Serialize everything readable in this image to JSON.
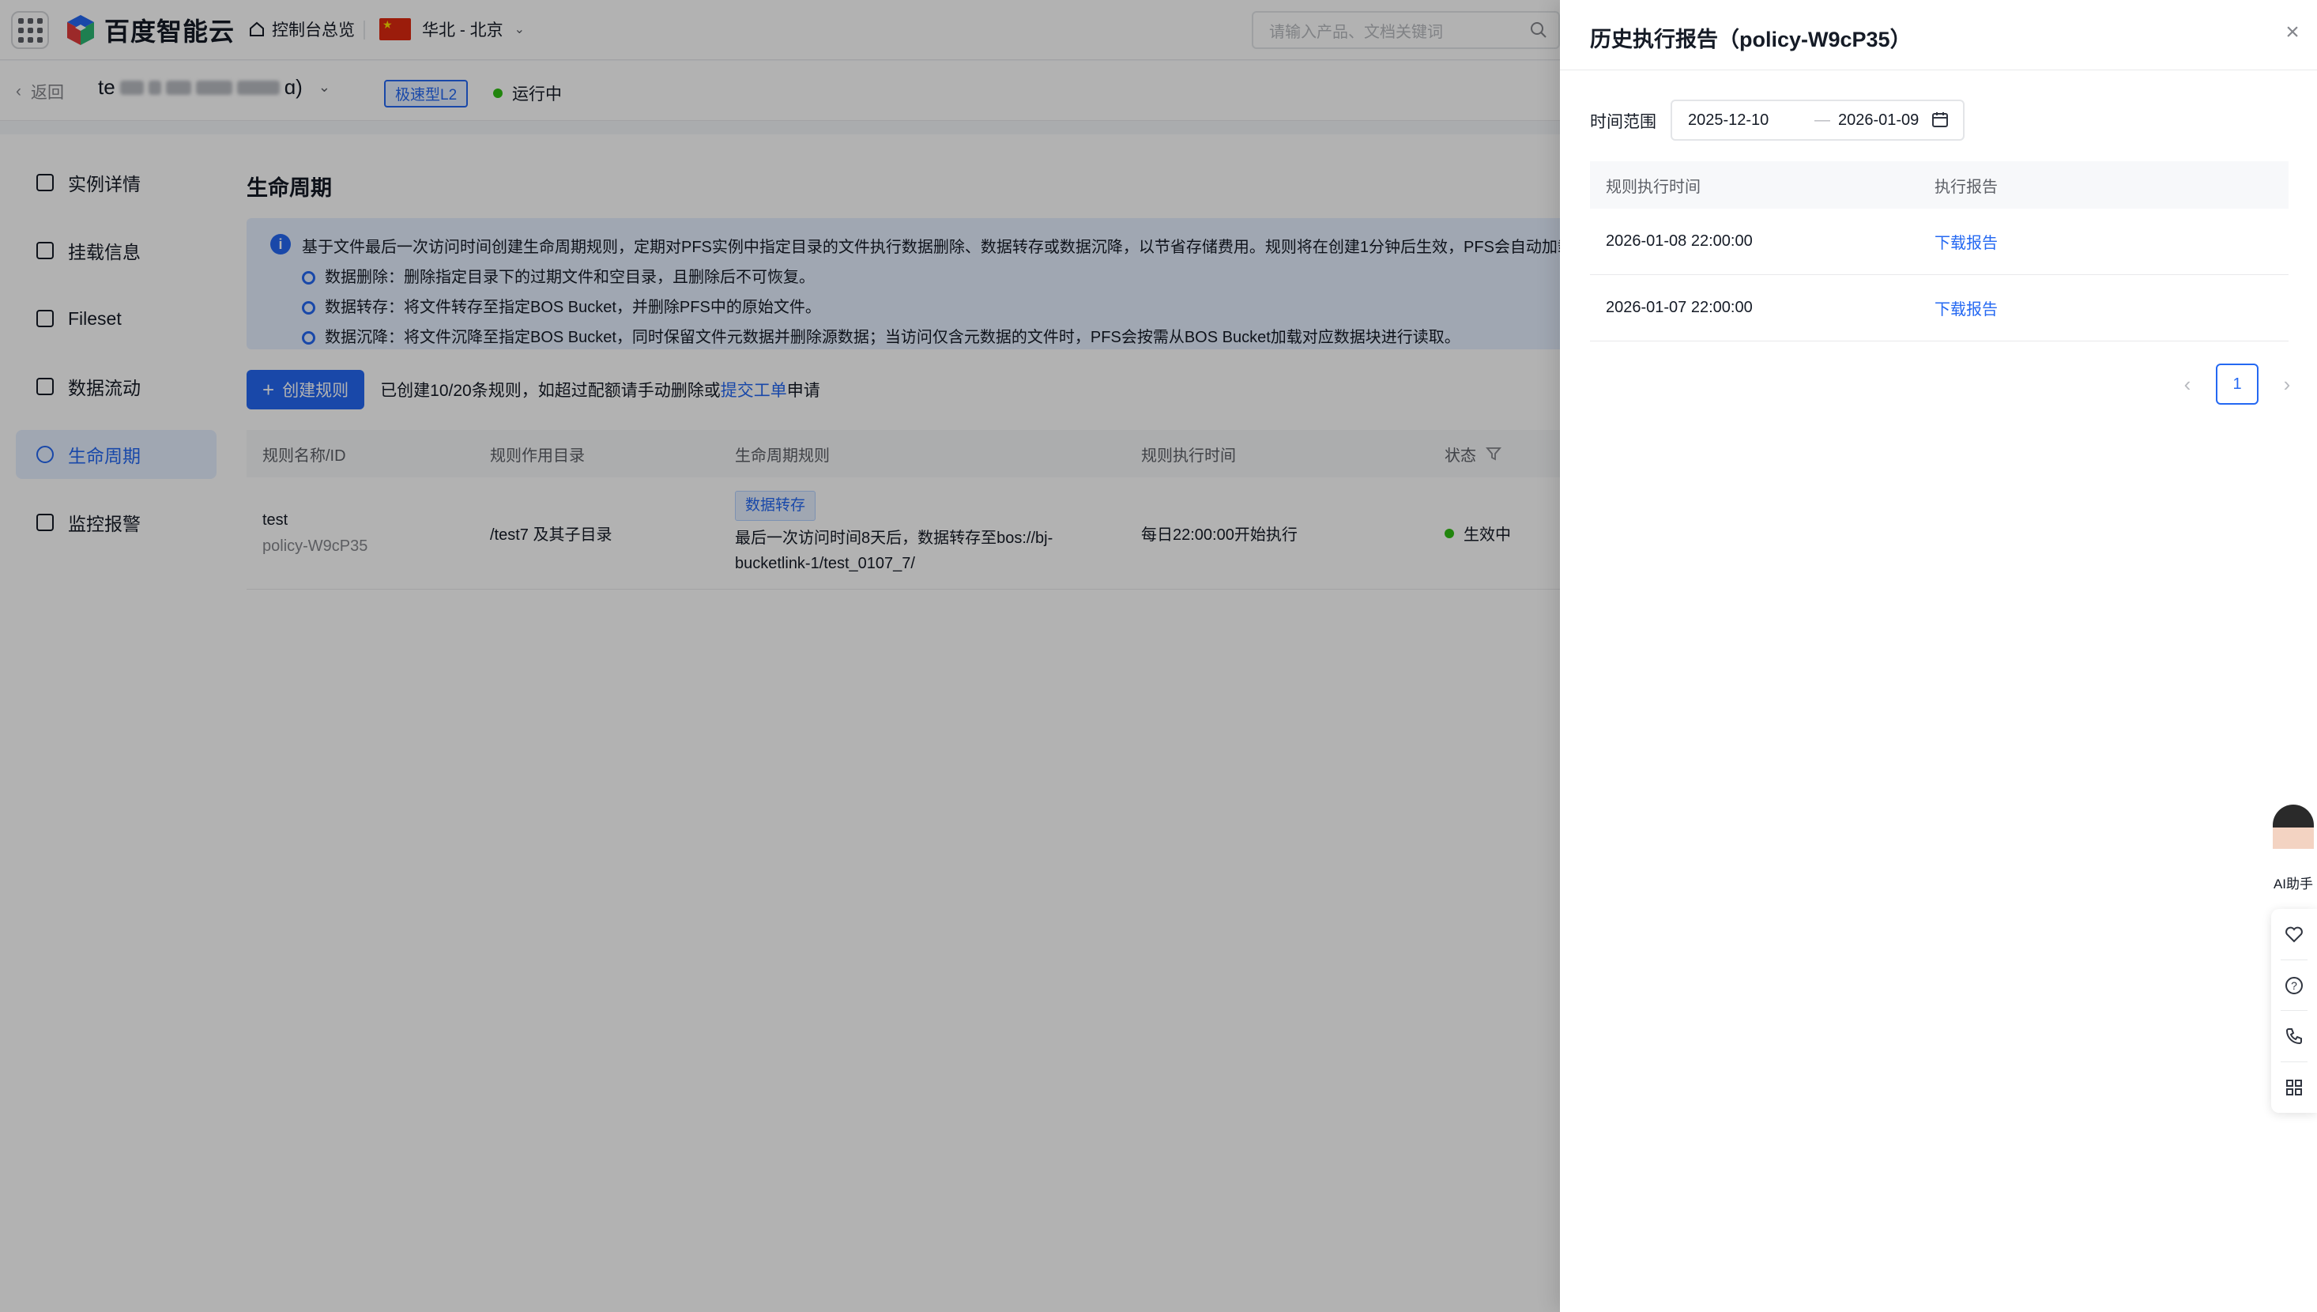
{
  "topbar": {
    "logo_text": "百度智能云",
    "console_label": "控制台总览",
    "region_label": "华北 - 北京",
    "search_placeholder": "请输入产品、文档关键词"
  },
  "subbar": {
    "back_label": "返回",
    "instance_prefix": "te",
    "instance_suffix": "ɑ)",
    "tier_tag": "极速型L2",
    "status_label": "运行中"
  },
  "sidebar": {
    "items": [
      {
        "label": "实例详情",
        "icon": "server-icon"
      },
      {
        "label": "挂载信息",
        "icon": "monitor-icon"
      },
      {
        "label": "Fileset",
        "icon": "folder-icon"
      },
      {
        "label": "数据流动",
        "icon": "image-icon"
      },
      {
        "label": "生命周期",
        "icon": "clock-icon"
      },
      {
        "label": "监控报警",
        "icon": "chart-icon"
      }
    ],
    "active_index": 4
  },
  "main": {
    "title": "生命周期",
    "info_main": "基于文件最后一次访问时间创建生命周期规则，定期对PFS实例中指定目录的文件执行数据删除、数据转存或数据沉降，以节省存储费用。规则将在创建1分钟后生效，PFS会自动加载规则并",
    "info_bullets": [
      "数据删除：删除指定目录下的过期文件和空目录，且删除后不可恢复。",
      "数据转存：将文件转存至指定BOS Bucket，并删除PFS中的原始文件。",
      "数据沉降：将文件沉降至指定BOS Bucket，同时保留文件元数据并删除源数据；当访问仅含元数据的文件时，PFS会按需从BOS Bucket加载对应数据块进行读取。"
    ],
    "create_button": "创建规则",
    "quota_text_before": "已创建10/20条规则，如超过配额请手动删除或",
    "quota_link": "提交工单",
    "quota_text_after": "申请",
    "table": {
      "headers": [
        "规则名称/ID",
        "规则作用目录",
        "生命周期规则",
        "规则执行时间",
        "状态"
      ],
      "rows": [
        {
          "name": "test",
          "id": "policy-W9cP35",
          "dir": "/test7 及其子目录",
          "rule_tag": "数据转存",
          "rule_desc_1": "最后一次访问时间8天后，数据转存至bos://bj-",
          "rule_desc_2": "bucketlink-1/test_0107_7/",
          "exec_time": "每日22:00:00开始执行",
          "status": "生效中"
        }
      ]
    }
  },
  "drawer": {
    "title": "历史执行报告（policy-W9cP35）",
    "range_label": "时间范围",
    "range_start": "2025-12-10",
    "range_sep": "—",
    "range_end": "2026-01-09",
    "table": {
      "headers": [
        "规则执行时间",
        "执行报告"
      ],
      "rows": [
        {
          "time": "2026-01-08 22:00:00",
          "action": "下载报告"
        },
        {
          "time": "2026-01-07 22:00:00",
          "action": "下载报告"
        }
      ]
    },
    "pagination": {
      "current_page": "1"
    }
  },
  "floating": {
    "ai_label": "AI助手",
    "tools": [
      "heart-icon",
      "help-icon",
      "phone-icon",
      "apps-icon"
    ]
  },
  "colors": {
    "accent": "#2468f2",
    "status_green": "#30bf13",
    "info_bg": "#e6f0ff",
    "mask": "rgba(0,0,0,0.30)"
  }
}
